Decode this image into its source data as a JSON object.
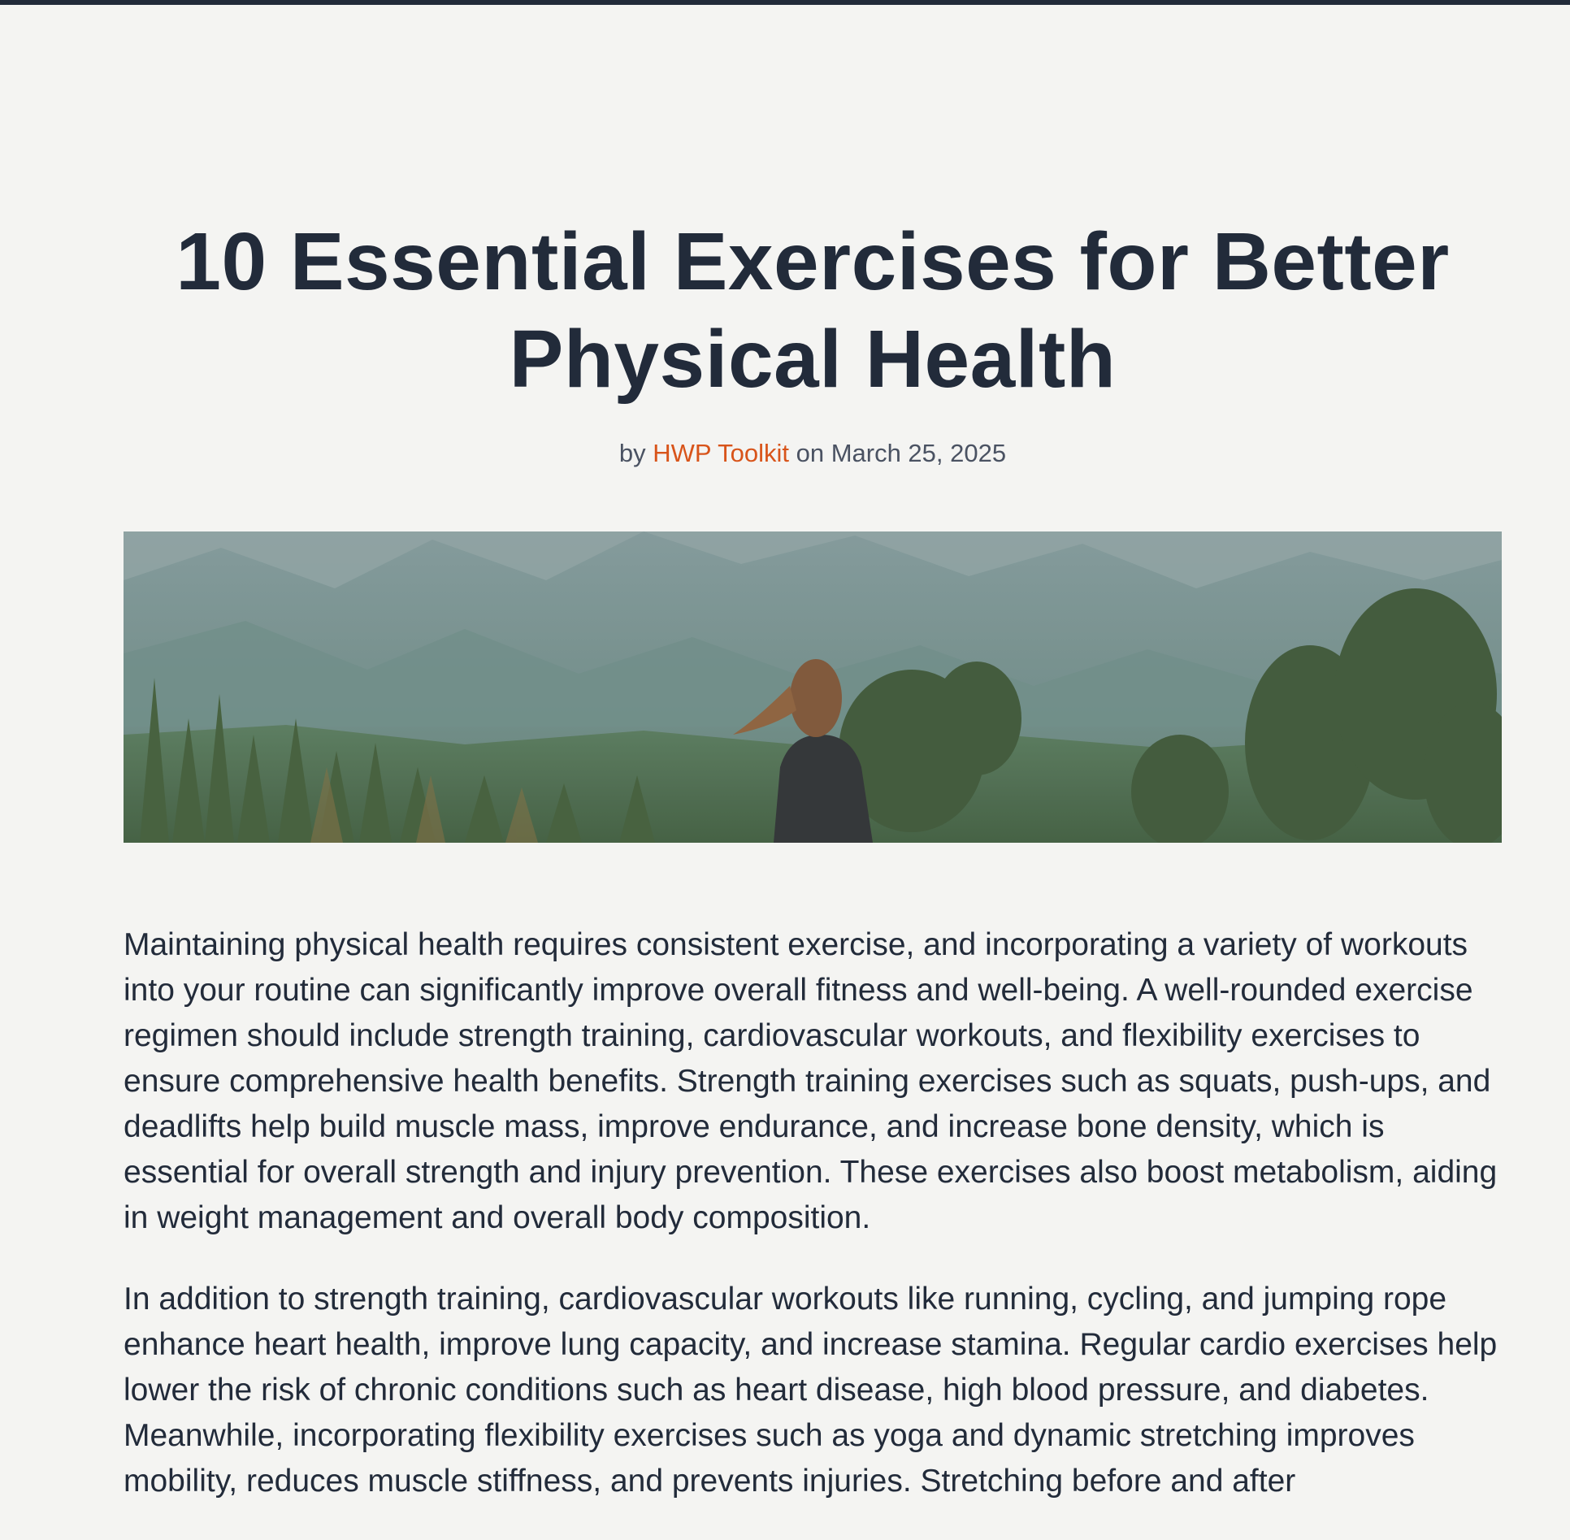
{
  "article": {
    "title": "10 Essential Exercises for Better Physical Health",
    "byline": {
      "by": "by",
      "author": "HWP Toolkit",
      "on": "on",
      "date": "March 25, 2025"
    },
    "paragraphs": [
      "Maintaining physical health requires consistent exercise, and incorporating a variety of workouts into your routine can significantly improve overall fitness and well-being. A well-rounded exercise regimen should include strength training, cardiovascular workouts, and flexibility exercises to ensure comprehensive health benefits. Strength training exercises such as squats, push-ups, and deadlifts help build muscle mass, improve endurance, and increase bone density, which is essential for overall strength and injury prevention. These exercises also boost metabolism, aiding in weight management and overall body composition.",
      "In addition to strength training, cardiovascular workouts like running, cycling, and jumping rope enhance heart health, improve lung capacity, and increase stamina. Regular cardio exercises help lower the risk of chronic conditions such as heart disease, high blood pressure, and diabetes. Meanwhile, incorporating flexibility exercises such as yoga and dynamic stretching improves mobility, reduces muscle stiffness, and prevents injuries. Stretching before and after"
    ]
  },
  "colors": {
    "background": "#f4f4f2",
    "text": "#222b3a",
    "accent": "#d8541a",
    "meta": "#4a5262"
  }
}
